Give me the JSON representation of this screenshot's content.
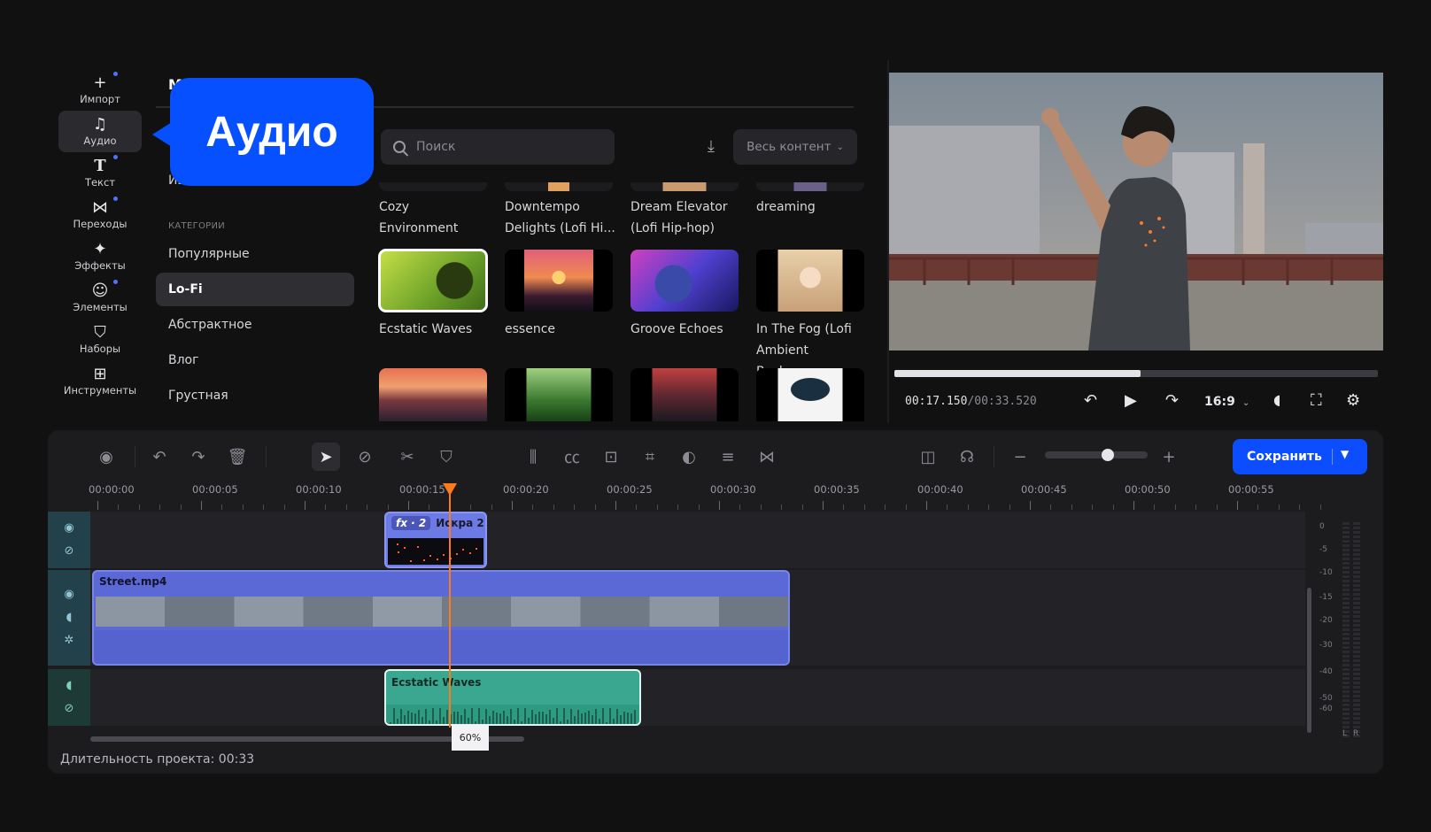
{
  "sidebar": {
    "items": [
      {
        "label": "Импорт",
        "icon": "plus-icon"
      },
      {
        "label": "Аудио",
        "icon": "music-note-icon"
      },
      {
        "label": "Текст",
        "icon": "text-icon"
      },
      {
        "label": "Переходы",
        "icon": "transition-icon"
      },
      {
        "label": "Эффекты",
        "icon": "sparkle-icon"
      },
      {
        "label": "Элементы",
        "icon": "smiley-icon"
      },
      {
        "label": "Наборы",
        "icon": "bag-icon"
      },
      {
        "label": "Инструменты",
        "icon": "grid-plus-icon"
      }
    ]
  },
  "callout": {
    "label": "Аудио"
  },
  "library": {
    "title_partial": "М",
    "favorites_partial": "Изб",
    "categories_header": "КАТЕГОРИИ",
    "categories": [
      "Популярные",
      "Lo-Fi",
      "Абстрактное",
      "Влог",
      "Грустная"
    ],
    "search_placeholder": "Поиск",
    "filter_label": "Весь контент"
  },
  "tracks": {
    "row1": [
      {
        "title": "Cozy Environment"
      },
      {
        "title": "Downtempo Delights (Lofi Hi..."
      },
      {
        "title": "Dream Elevator (Lofi Hip-hop)"
      },
      {
        "title": "dreaming"
      }
    ],
    "row2": [
      {
        "title": "Ecstatic Waves",
        "thumb": "green-woman-headphones"
      },
      {
        "title": "essence",
        "thumb": "sunset-palms"
      },
      {
        "title": "Groove Echoes",
        "thumb": "neon-robot-face"
      },
      {
        "title": "In The Fog (Lofi Ambient Backgr...",
        "thumb": "anime-girl-headphones"
      }
    ]
  },
  "player": {
    "time_current": "00:17.150",
    "time_total": "/00:33.520",
    "progress": 0.51,
    "aspect": "16:9"
  },
  "timeline": {
    "save_label": "Сохранить",
    "ruler": [
      "00:00:00",
      "00:00:05",
      "00:00:10",
      "00:00:15",
      "00:00:20",
      "00:00:25",
      "00:00:30",
      "00:00:35",
      "00:00:40",
      "00:00:45",
      "00:00:50",
      "00:00:55"
    ],
    "fx_clip": {
      "badge": "fx · 2",
      "name": "Искра 2"
    },
    "video_clip": {
      "name": "Street.mp4"
    },
    "audio_clip": {
      "name": "Ecstatic Waves"
    },
    "volume_label": "60%",
    "meter_db": [
      "0",
      "-5",
      "-10",
      "-15",
      "-20",
      "-30",
      "-40",
      "-50",
      "-60"
    ],
    "meter_channels": [
      "L",
      "R"
    ],
    "duration": "Длительность проекта: 00:33"
  },
  "colors": {
    "accent": "#0b4dff",
    "playhead": "#ff7a1a",
    "video_clip": "#5b69d6",
    "audio_clip": "#3aa890"
  }
}
